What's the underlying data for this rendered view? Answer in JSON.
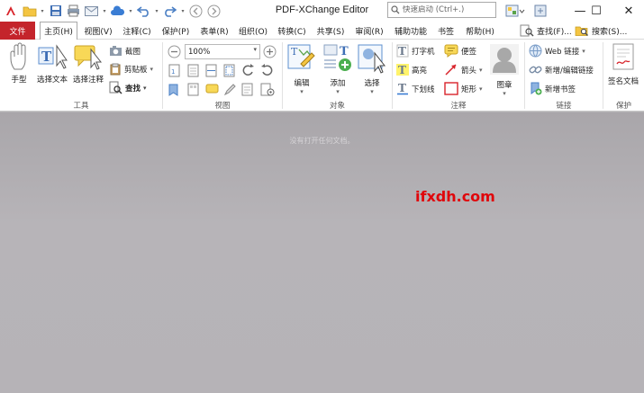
{
  "window": {
    "title": "PDF-XChange Editor",
    "quick_launch_placeholder": "快速启动 (Ctrl+.)",
    "minimize": "—",
    "maximize": "☐",
    "close": "✕"
  },
  "menu": {
    "file": "文件",
    "items": [
      "主页(H)",
      "视图(V)",
      "注释(C)",
      "保护(P)",
      "表单(R)",
      "组织(O)",
      "转换(C)",
      "共享(S)",
      "审阅(R)",
      "辅助功能",
      "书签",
      "帮助(H)"
    ],
    "active_index": 0,
    "find_label": "查找(F)...",
    "search_label": "搜索(S)..."
  },
  "ribbon": {
    "tools": {
      "group_label": "工具",
      "hand": "手型",
      "select_text": "选择文本",
      "select_comment": "选择注释",
      "snapshot": "截图",
      "clipboard": "剪贴板",
      "find": "查找"
    },
    "view": {
      "group_label": "视图",
      "zoom_value": "100%"
    },
    "objects": {
      "group_label": "对象",
      "edit": "编辑",
      "add": "添加",
      "select": "选择"
    },
    "comment": {
      "group_label": "注释",
      "typewriter": "打字机",
      "sticky_note": "便签",
      "highlight": "高亮",
      "arrow": "箭头",
      "underline": "下划线",
      "rectangle": "矩形",
      "stamp": "图章"
    },
    "links": {
      "group_label": "链接",
      "web_links": "Web 链接",
      "new_edit_link": "新增/编辑链接",
      "new_bookmark": "新增书签"
    },
    "protect": {
      "group_label": "保护",
      "sign_document": "签名文档"
    }
  },
  "workspace": {
    "empty_message": "没有打开任何文档。",
    "watermark": "ifxdh.com"
  },
  "colors": {
    "file_tab": "#c4242b",
    "workspace": "#b4b1b5",
    "watermark": "#e0060b"
  }
}
